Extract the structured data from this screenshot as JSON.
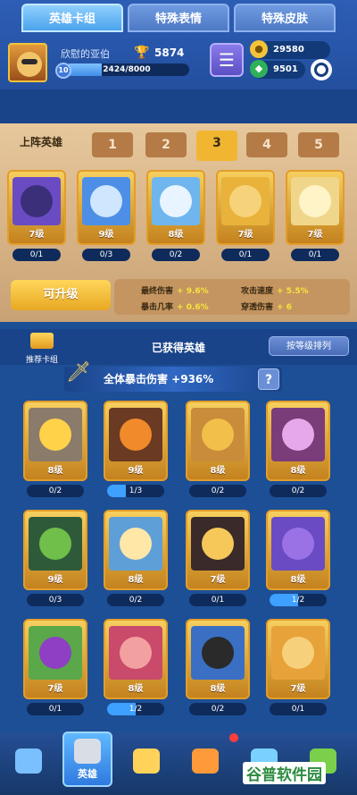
{
  "player": {
    "name": "欣慰的亚伯",
    "trophies": "5874",
    "level": "10",
    "xp_text": "2424/8000",
    "xp_fraction": 0.303
  },
  "currency": {
    "gold": "29580",
    "gems": "9501"
  },
  "tabs": [
    {
      "label": "英雄卡组",
      "active": true
    },
    {
      "label": "特殊表情",
      "active": false
    },
    {
      "label": "特殊皮肤",
      "active": false
    }
  ],
  "lineup": {
    "title": "上阵英雄",
    "slots": [
      "1",
      "2",
      "3",
      "4",
      "5"
    ],
    "active_slot": "3",
    "heroes": [
      {
        "level": "7级",
        "progress": "0/1",
        "color": "#6a4bc4",
        "face": "#3b2f7a"
      },
      {
        "level": "9级",
        "progress": "0/3",
        "color": "#4d8fe6",
        "face": "#cfe6ff"
      },
      {
        "level": "8级",
        "progress": "0/2",
        "color": "#6fb6ef",
        "face": "#e8f4ff"
      },
      {
        "level": "7级",
        "progress": "0/1",
        "color": "#e9b23a",
        "face": "#f6d37a"
      },
      {
        "level": "7级",
        "progress": "0/1",
        "color": "#f0d68a",
        "face": "#fff4c8"
      }
    ],
    "upgrade_label": "可升级",
    "stats": [
      {
        "label": "最终伤害",
        "value": "+ 9.6%"
      },
      {
        "label": "攻击速度",
        "value": "+ 5.5%"
      },
      {
        "label": "暴击几率",
        "value": "+ 0.6%"
      },
      {
        "label": "穿透伤害",
        "value": "+ 6"
      }
    ]
  },
  "owned": {
    "recommend_label": "推荐卡组",
    "title": "已获得英雄",
    "sort_label": "按等级排列",
    "crit_text": "全体暴击伤害 +936%",
    "help": "?",
    "heroes": [
      {
        "level": "8级",
        "progress": "0/2",
        "fill": 0,
        "color": "#8a7b6a",
        "face": "#ffd24a"
      },
      {
        "level": "9级",
        "progress": "1/3",
        "fill": 0.33,
        "color": "#6b3a22",
        "face": "#f08a2a"
      },
      {
        "level": "8级",
        "progress": "0/2",
        "fill": 0,
        "color": "#c98c3a",
        "face": "#f2c04a"
      },
      {
        "level": "8级",
        "progress": "0/2",
        "fill": 0,
        "color": "#7b3c7a",
        "face": "#e6a8e8"
      },
      {
        "level": "9级",
        "progress": "0/3",
        "fill": 0,
        "color": "#2f5a3a",
        "face": "#6fbf4a"
      },
      {
        "level": "8级",
        "progress": "0/2",
        "fill": 0,
        "color": "#5f9fd8",
        "face": "#ffe7a8"
      },
      {
        "level": "7级",
        "progress": "0/1",
        "fill": 0,
        "color": "#3a2a2a",
        "face": "#f6c85a"
      },
      {
        "level": "8级",
        "progress": "1/2",
        "fill": 0.5,
        "color": "#6a4bc4",
        "face": "#9a72e6"
      },
      {
        "level": "7级",
        "progress": "0/1",
        "fill": 0,
        "color": "#5aa84a",
        "face": "#8e3fc4"
      },
      {
        "level": "8级",
        "progress": "1/2",
        "fill": 0.5,
        "color": "#c94a6a",
        "face": "#f2a0a0"
      },
      {
        "level": "8级",
        "progress": "0/2",
        "fill": 0,
        "color": "#3a6fc4",
        "face": "#2a2a2a"
      },
      {
        "level": "7级",
        "progress": "0/1",
        "fill": 0,
        "color": "#e8a23a",
        "face": "#f6d07a"
      }
    ]
  },
  "nav": [
    {
      "label": "",
      "icon": "chest-icon"
    },
    {
      "label": "英雄",
      "icon": "knight-helmet-icon"
    },
    {
      "label": "",
      "icon": "crossed-swords-icon"
    },
    {
      "label": "",
      "icon": "crown-shield-icon"
    },
    {
      "label": "",
      "icon": "gift-icon"
    },
    {
      "label": "",
      "icon": "sprout-icon"
    }
  ],
  "watermark": "谷普软件园"
}
